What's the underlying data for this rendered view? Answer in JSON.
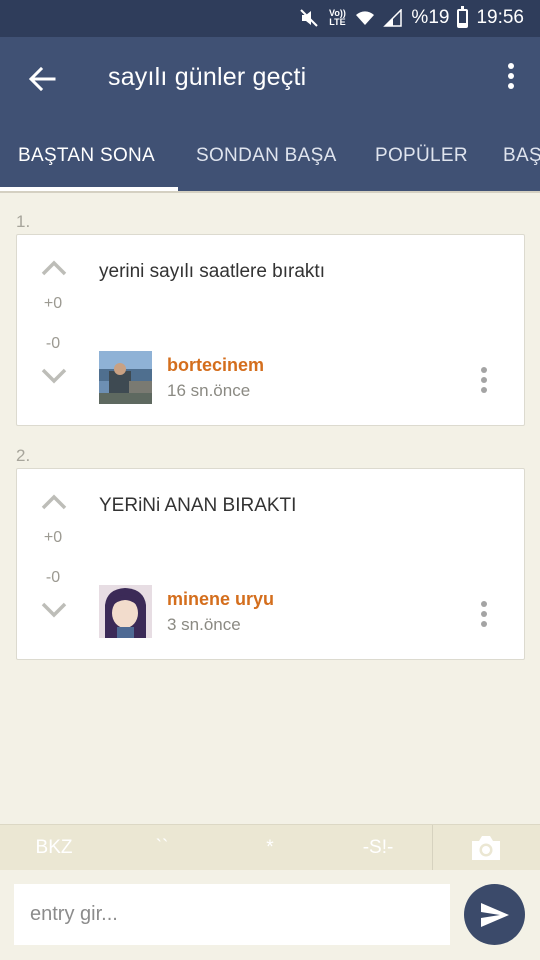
{
  "status_bar": {
    "battery": "%19",
    "time": "19:56",
    "network_label": "Vo)) LTE",
    "battery_level": 0.19,
    "icons": [
      "mute-icon",
      "volte-icon",
      "wifi-icon",
      "signal-icon",
      "battery-icon"
    ]
  },
  "app_bar": {
    "title": "sayılı günler geçti",
    "icons": [
      "back-arrow-icon",
      "more-vert-icon"
    ]
  },
  "tabs": [
    {
      "label": "BAŞTAN SONA",
      "active": true
    },
    {
      "label": "SONDAN BAŞA",
      "active": false
    },
    {
      "label": "POPÜLER",
      "active": false
    },
    {
      "label": "BAŞ",
      "active": false
    }
  ],
  "entries": [
    {
      "number": "1.",
      "text": "yerini sayılı saatlere bıraktı",
      "upvotes": "+0",
      "downvotes": "-0",
      "author": "bortecinem",
      "time": "16 sn.önce"
    },
    {
      "number": "2.",
      "text": "YERiNi ANAN BIRAKTI",
      "upvotes": "+0",
      "downvotes": "-0",
      "author": "minene uryu",
      "time": "3 sn.önce"
    }
  ],
  "format_bar": {
    "bkz": "BKZ",
    "hede": "``",
    "star": "*",
    "spoiler": "-S!-",
    "camera_icon": "camera-icon"
  },
  "input": {
    "placeholder": "entry gir...",
    "value": ""
  },
  "send_icon": "send-icon",
  "colors": {
    "status_bar": "#2f3d5b",
    "app_bar": "#405174",
    "background": "#f3f1e6",
    "author": "#d46e1d",
    "send_button": "#3b4a6a"
  }
}
